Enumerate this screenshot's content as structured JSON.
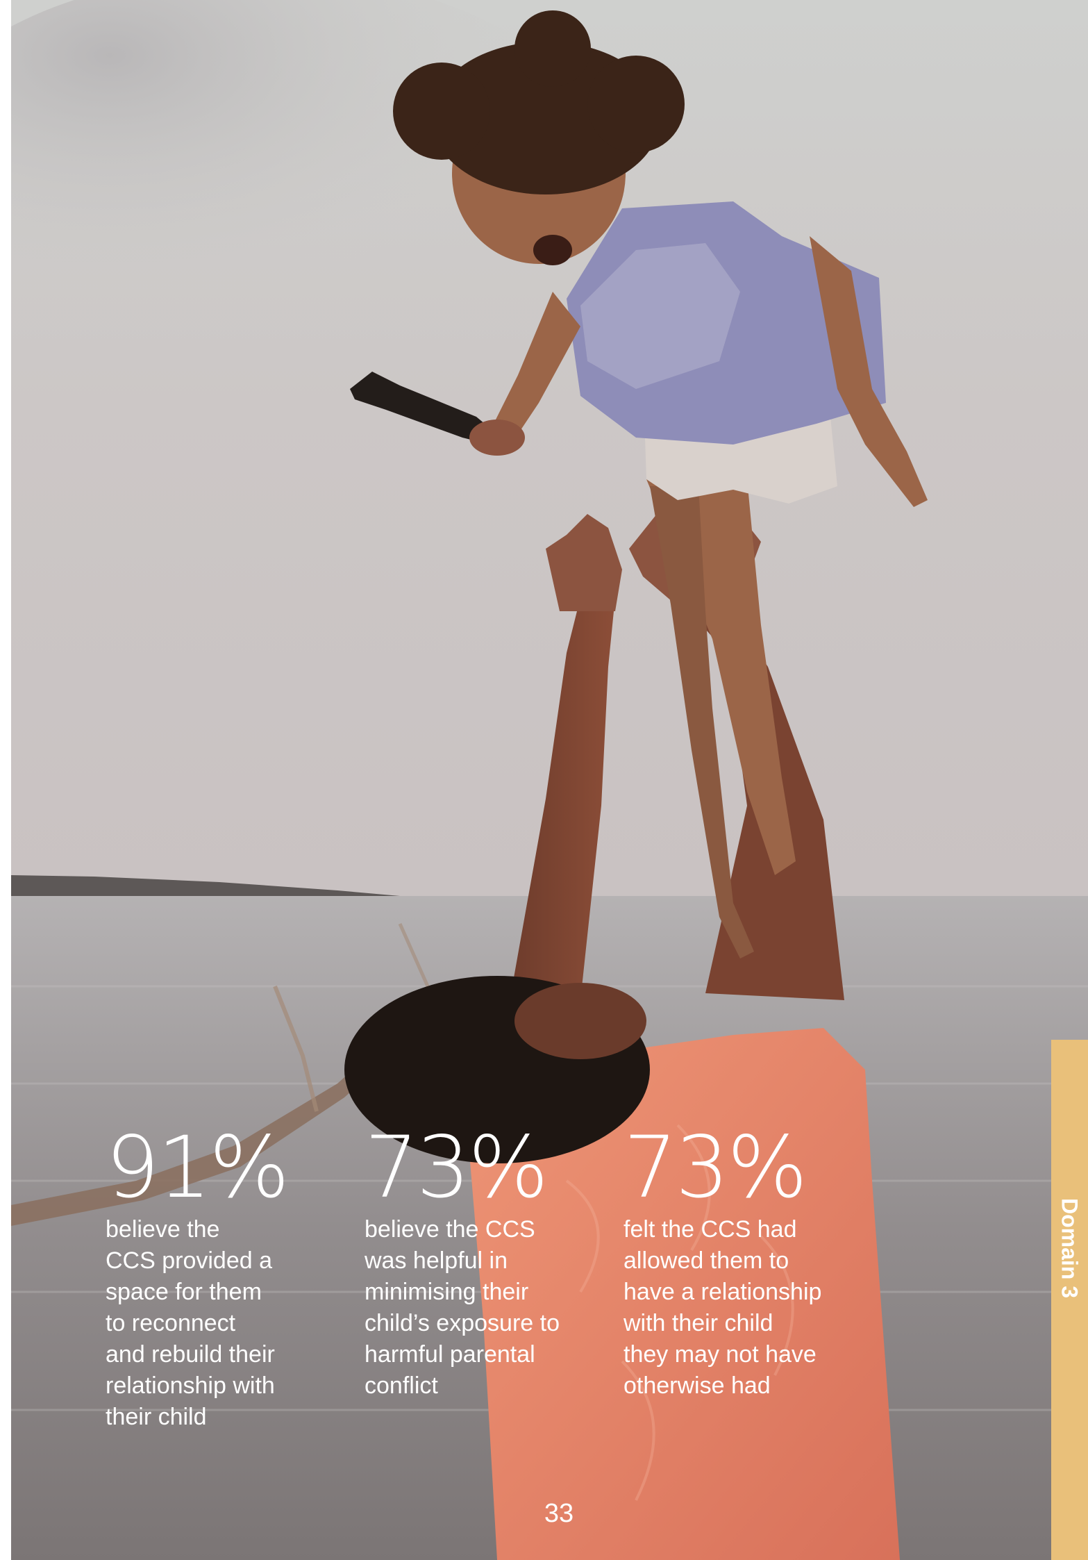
{
  "stats": [
    {
      "percent": "91%",
      "description": "believe the\nCCS provided a\nspace for them\nto reconnect\nand rebuild their\nrelationship with\ntheir child"
    },
    {
      "percent": "73%",
      "description": "believe the CCS\nwas helpful in\nminimising their\nchild’s exposure to\nharmful parental\nconflict"
    },
    {
      "percent": "73%",
      "description": "felt the CCS had\nallowed them to\nhave a relationship\nwith their child\nthey may not have\notherwise had"
    }
  ],
  "page_number": "33",
  "side_tab": {
    "label": "Domain 3",
    "color": "#e9c07a"
  },
  "colors": {
    "text": "#ffffff",
    "shirt": "#e8876a",
    "sky": "#cfcbc8",
    "water": "#9b9897"
  }
}
